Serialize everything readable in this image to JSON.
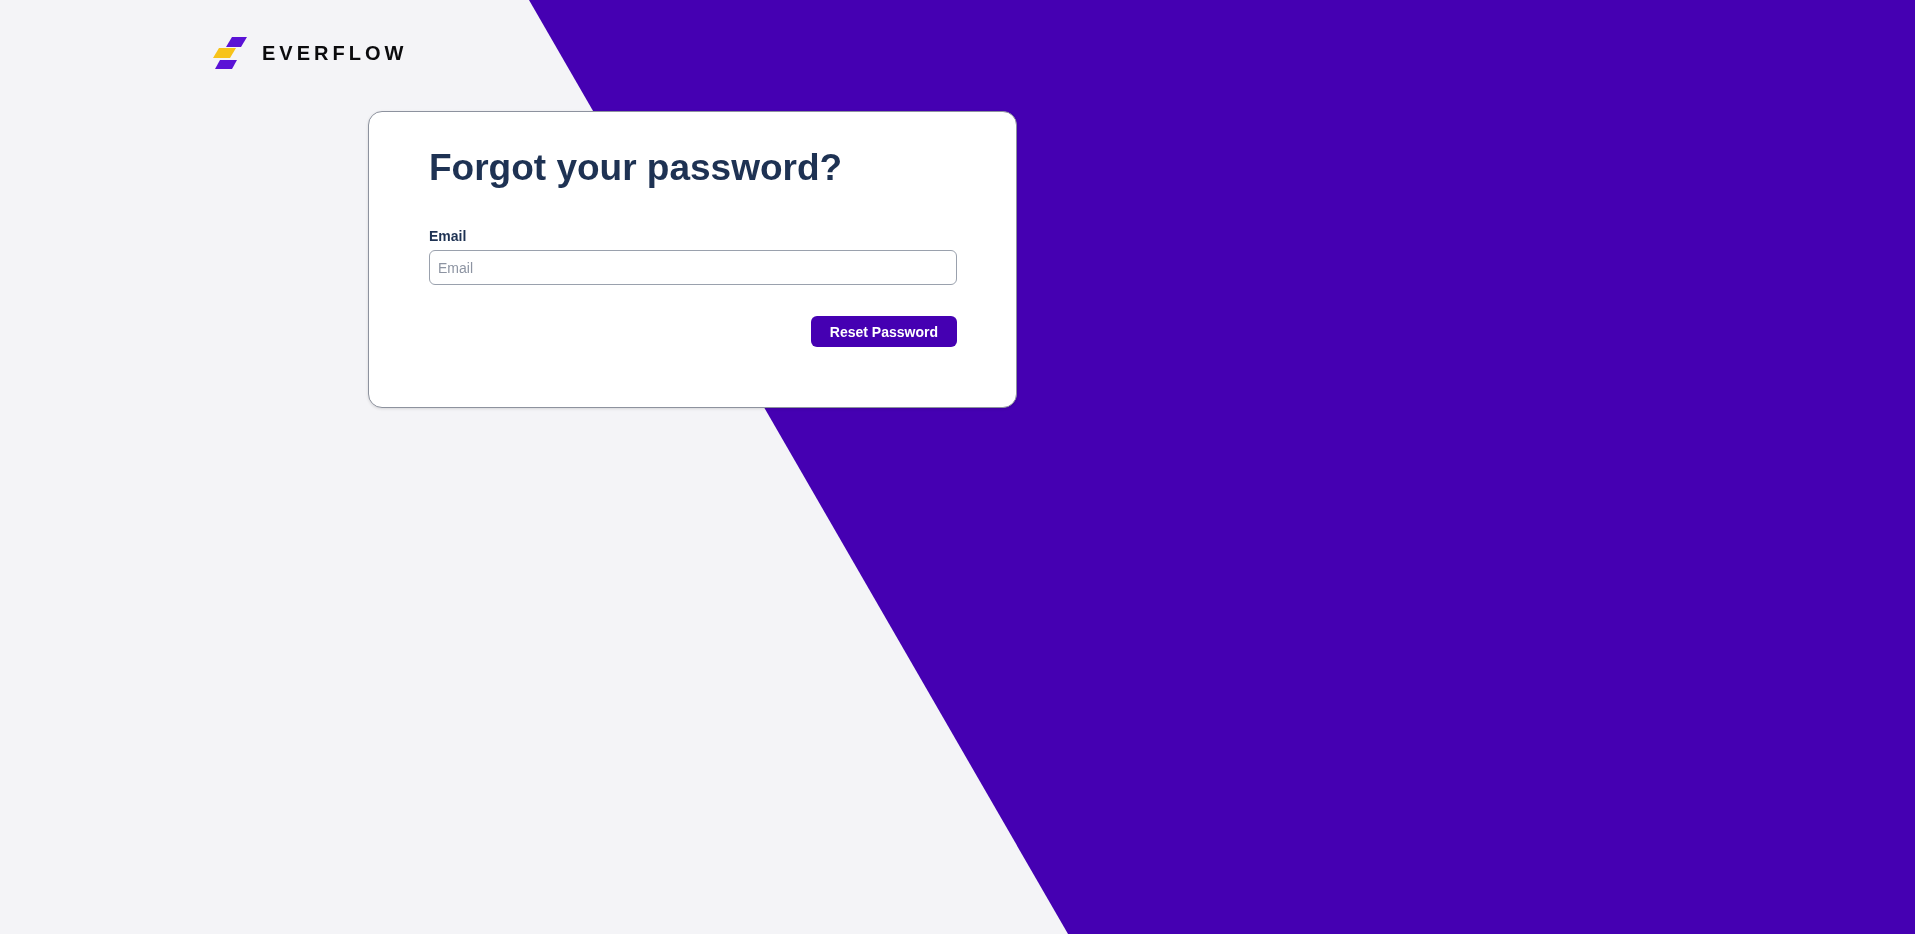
{
  "logo": {
    "text": "EVERFLOW"
  },
  "card": {
    "title": "Forgot your password?",
    "email_field": {
      "label": "Email",
      "placeholder": "Email"
    },
    "submit_button": {
      "label": "Reset Password"
    }
  }
}
